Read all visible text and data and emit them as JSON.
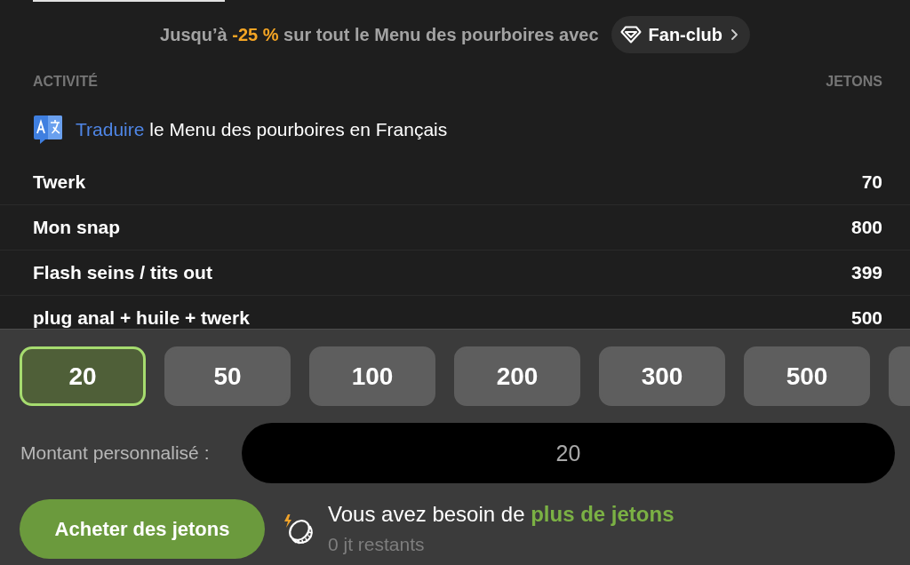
{
  "promo": {
    "prefix": "Jusqu’à",
    "discount": "-25 %",
    "suffix": "sur tout le Menu des pourboires avec",
    "badge": "Fan-club"
  },
  "table": {
    "columns": [
      "ACTIVITÉ",
      "JETONS"
    ],
    "translate": {
      "link": "Traduire",
      "text": "le Menu des pourboires en Français"
    },
    "rows": [
      {
        "activity": "Twerk",
        "tokens": "70"
      },
      {
        "activity": "Mon snap",
        "tokens": "800"
      },
      {
        "activity": "Flash seins / tits out",
        "tokens": "399"
      },
      {
        "activity": "plug anal + huile + twerk",
        "tokens": "500"
      }
    ]
  },
  "amounts": [
    {
      "label": "20",
      "selected": true
    },
    {
      "label": "50",
      "selected": false
    },
    {
      "label": "100",
      "selected": false
    },
    {
      "label": "200",
      "selected": false
    },
    {
      "label": "300",
      "selected": false
    },
    {
      "label": "500",
      "selected": false
    },
    {
      "selected": false
    }
  ],
  "custom_amount": {
    "label": "Montant personnalisé :",
    "value": "20"
  },
  "buy_button": "Acheter des jetons",
  "balance": {
    "message": "Vous avez besoin de",
    "link": "plus de jetons",
    "remaining": "0 jt restants"
  }
}
